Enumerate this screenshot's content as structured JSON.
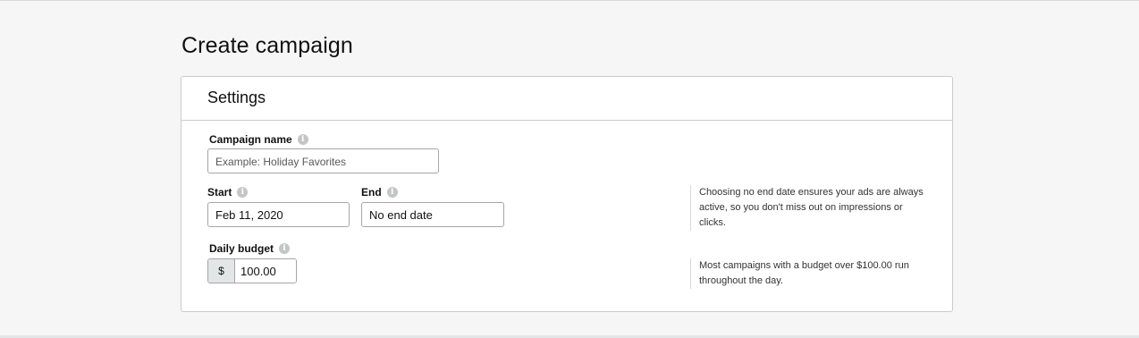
{
  "page": {
    "title": "Create campaign"
  },
  "settings": {
    "section_title": "Settings",
    "campaign_name": {
      "label": "Campaign name",
      "value": "",
      "placeholder": "Example: Holiday Favorites"
    },
    "start": {
      "label": "Start",
      "value": "Feb 11, 2020"
    },
    "end": {
      "label": "End",
      "value": "No end date"
    },
    "end_hint": "Choosing no end date ensures your ads are always active, so you don't miss out on impressions or clicks.",
    "daily_budget": {
      "label": "Daily budget",
      "currency_symbol": "$",
      "value": "100.00"
    },
    "budget_hint": "Most campaigns with a budget over $100.00 run throughout the day."
  },
  "icons": {
    "info": "info-icon",
    "info_glyph": "i"
  },
  "colors": {
    "background": "#f6f6f6",
    "card": "#ffffff",
    "border": "#c9cccc"
  }
}
